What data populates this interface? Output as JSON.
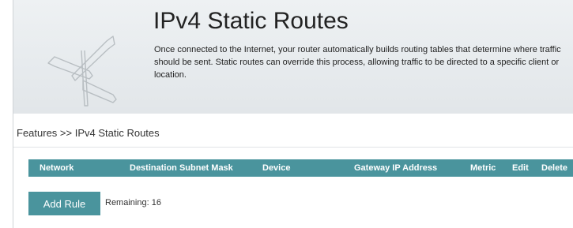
{
  "page": {
    "title": "IPv4 Static Routes",
    "description": "Once connected to the Internet, your router automatically builds routing tables that determine where traffic should be sent. Static routes can override this process, allowing traffic to be directed to a specific client or location.",
    "header_icon": "signpost-icon"
  },
  "breadcrumb": {
    "text": "Features >> IPv4 Static Routes"
  },
  "table": {
    "columns": [
      "Network",
      "Destination Subnet Mask",
      "Device",
      "Gateway IP Address",
      "Metric",
      "Edit",
      "Delete"
    ],
    "rows": []
  },
  "actions": {
    "add_rule_label": "Add Rule",
    "remaining_label": "Remaining:",
    "remaining_count": "16"
  },
  "colors": {
    "accent": "#4a949d",
    "header_background": "#e7ebee",
    "text": "#222222"
  }
}
